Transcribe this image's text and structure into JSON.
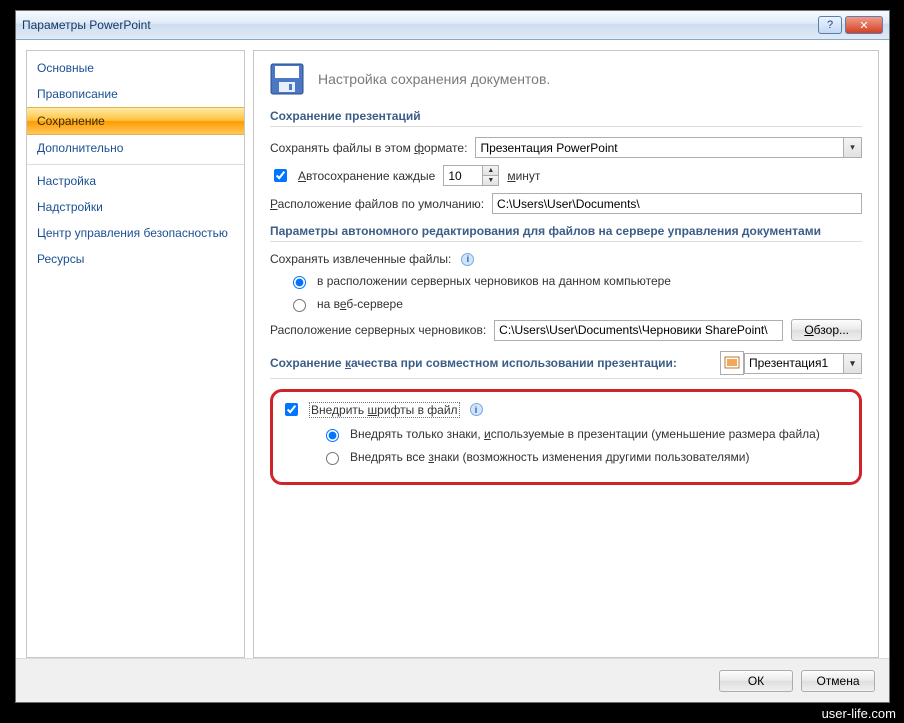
{
  "window": {
    "title": "Параметры PowerPoint"
  },
  "sidebar": {
    "items": [
      {
        "label": "Основные"
      },
      {
        "label": "Правописание"
      },
      {
        "label": "Сохранение"
      },
      {
        "label": "Дополнительно"
      },
      {
        "label": "Настройка"
      },
      {
        "label": "Надстройки"
      },
      {
        "label": "Центр управления безопасностью"
      },
      {
        "label": "Ресурсы"
      }
    ],
    "active_index": 2
  },
  "main": {
    "header": "Настройка сохранения документов.",
    "sect1": {
      "title": "Сохранение презентаций",
      "format_label_pre": "Сохранять файлы в этом ",
      "format_label_u": "ф",
      "format_label_post": "ормате:",
      "format_value": "Презентация PowerPoint",
      "autosave_pre": "А",
      "autosave_post": "втосохранение каждые",
      "autosave_value": "10",
      "autosave_unit_u": "м",
      "autosave_unit": "инут",
      "loc_pre": "Р",
      "loc_post": "асположение файлов по умолчанию:",
      "loc_value": "C:\\Users\\User\\Documents\\"
    },
    "sect2": {
      "title": "Параметры автономного редактирования для файлов на сервере управления документами",
      "extract_label": "Сохранять извлеченные файлы:",
      "opt1": "в расположении серверных черновиков на данном компьютере",
      "opt2_pre": "на в",
      "opt2_u": "е",
      "opt2_post": "б-сервере",
      "drafts_label": "Расположение серверных черновиков:",
      "drafts_value": "C:\\Users\\User\\Documents\\Черновики SharePoint\\",
      "browse_u": "О",
      "browse": "бзор..."
    },
    "sect3": {
      "title_pre": "Сохранение ",
      "title_u": "к",
      "title_post": "ачества при совместном использовании презентации:",
      "pres_value": "Презентация1",
      "embed_pre": "Внедрить ",
      "embed_u": "ш",
      "embed_post": "рифты в файл",
      "fopt1_pre": "Внедрять только знаки, ",
      "fopt1_u": "и",
      "fopt1_post": "спользуемые в презентации (уменьшение размера файла)",
      "fopt2_pre": "Внедрять все ",
      "fopt2_u": "з",
      "fopt2_post": "наки (возможность изменения другими пользователями)"
    }
  },
  "footer": {
    "ok": "ОК",
    "cancel": "Отмена"
  },
  "watermark": "user-life.com"
}
